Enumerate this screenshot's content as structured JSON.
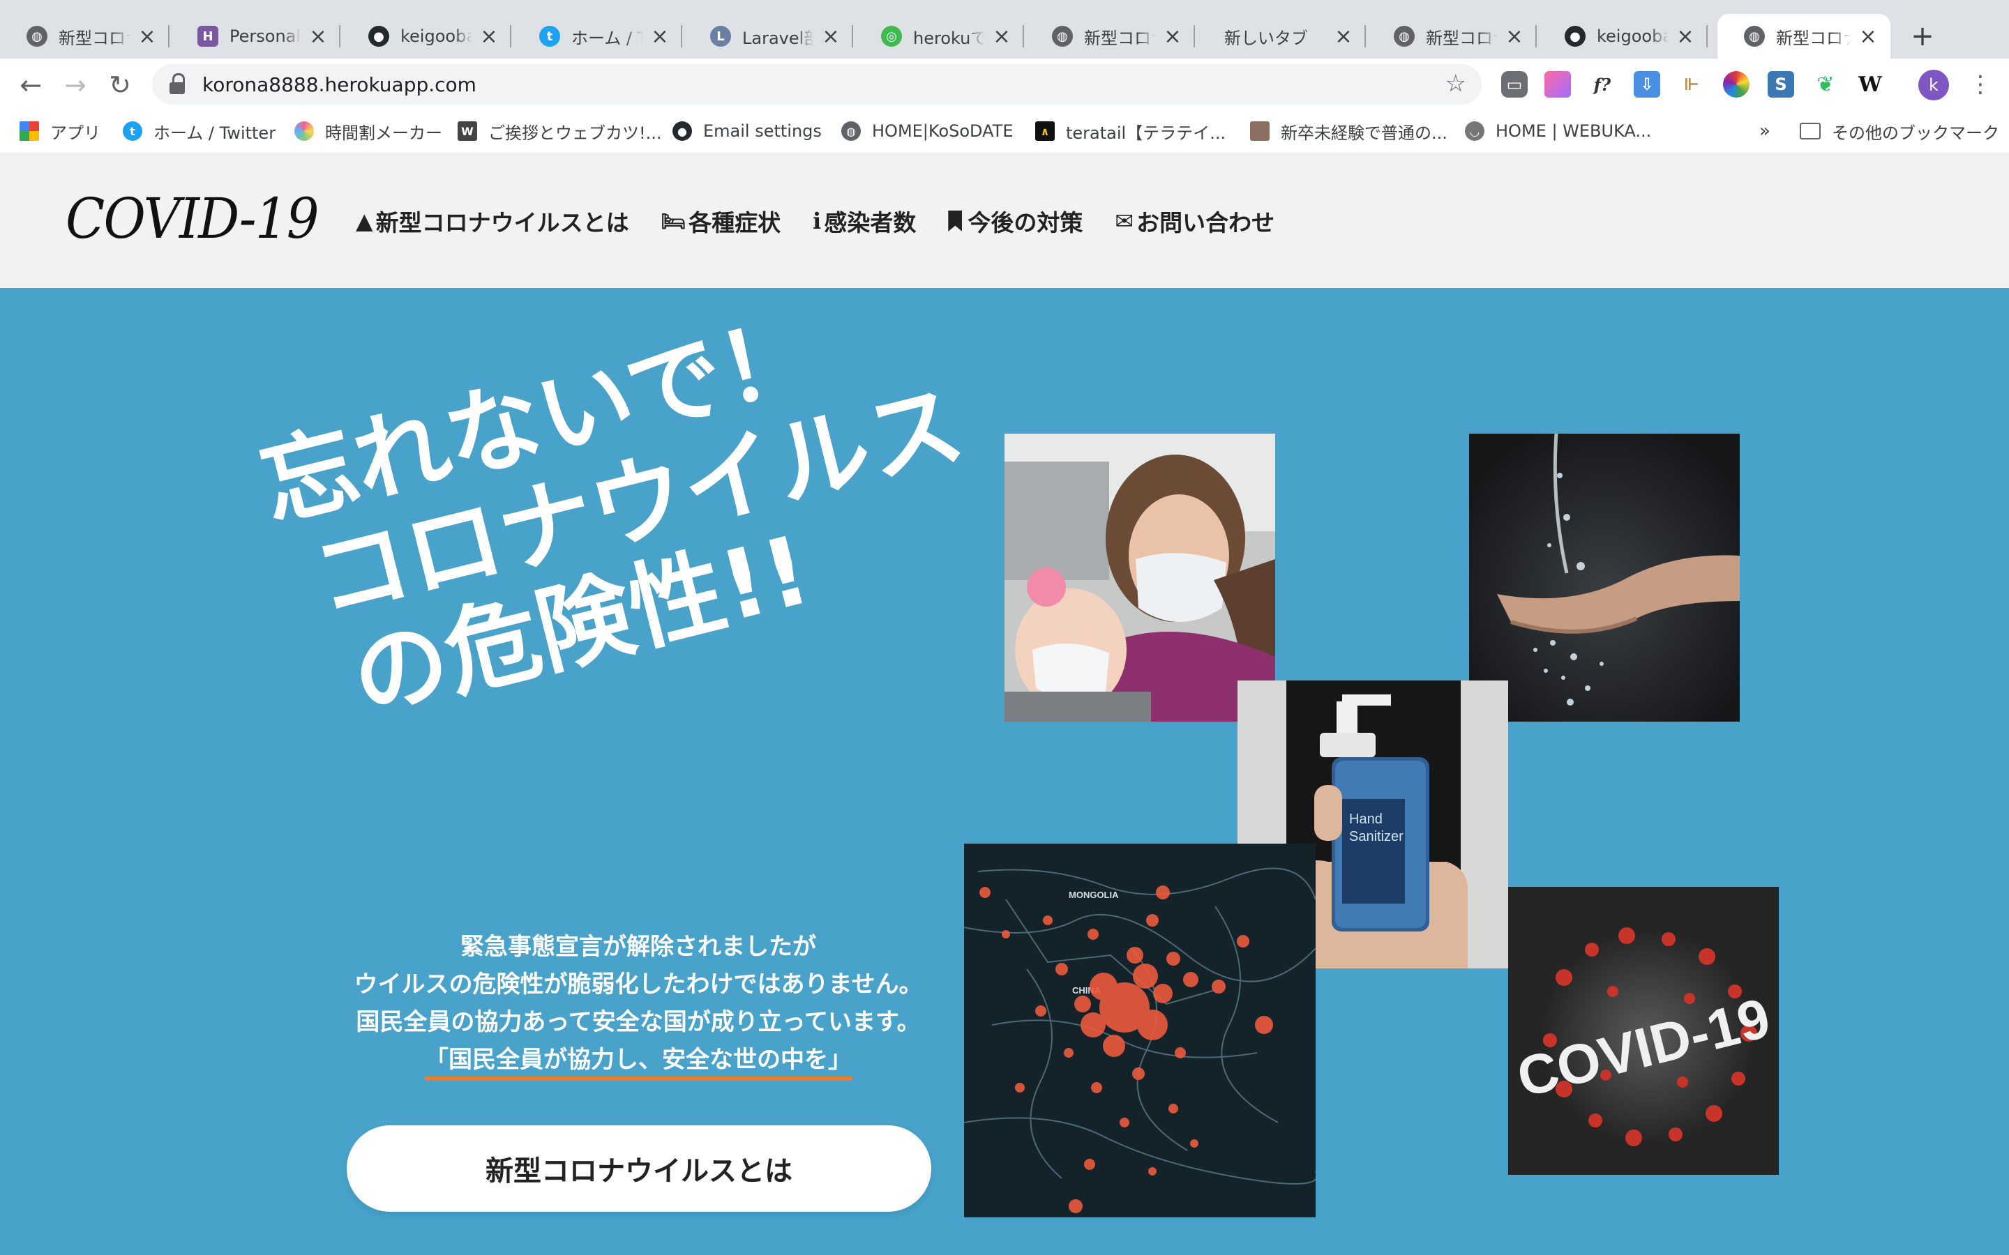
{
  "browser": {
    "tabs": [
      {
        "title": "新型コロナウイルス",
        "favicon": "globe-icon"
      },
      {
        "title": "Personal access",
        "favicon": "heroku-icon"
      },
      {
        "title": "keigooba/korona",
        "favicon": "github-icon"
      },
      {
        "title": "ホーム / Twitter",
        "favicon": "twitter-icon"
      },
      {
        "title": "Laravel部屋",
        "favicon": "laravel-icon"
      },
      {
        "title": "herokuでLaravel",
        "favicon": "heroku-icon"
      },
      {
        "title": "新型コロナウイルス",
        "favicon": "globe-icon"
      },
      {
        "title": "新しいタブ",
        "favicon": ""
      },
      {
        "title": "新型コロナウイルス",
        "favicon": "globe-icon"
      },
      {
        "title": "keigooba/korona",
        "favicon": "github-icon"
      },
      {
        "title": "新型コロナウイルス",
        "favicon": "globe-icon",
        "active": true
      }
    ],
    "url": "korona8888.herokuapp.com",
    "profile_initial": "k",
    "bookmarks": [
      {
        "label": "アプリ",
        "icon": "apps-grid-icon"
      },
      {
        "label": "ホーム / Twitter",
        "icon": "twitter-icon"
      },
      {
        "label": "時間割メーカー",
        "icon": "pie-icon"
      },
      {
        "label": "ご挨拶とウェブカツ!...",
        "icon": "webukatu-icon"
      },
      {
        "label": "Email settings",
        "icon": "github-icon"
      },
      {
        "label": "HOME|KoSoDATE",
        "icon": "globe-icon"
      },
      {
        "label": "teratail【テラテイ...",
        "icon": "teratail-icon"
      },
      {
        "label": "新卒未経験で普通の...",
        "icon": "avatar-icon"
      },
      {
        "label": "HOME | WEBUKA...",
        "icon": "ghost-icon"
      }
    ],
    "bookmarks_overflow": "»",
    "other_bookmarks": "その他のブックマーク"
  },
  "site": {
    "logo": "COVID-19",
    "nav": [
      {
        "label": "新型コロナウイルスとは",
        "icon": "warning-triangle-icon"
      },
      {
        "label": "各種症状",
        "icon": "bed-icon"
      },
      {
        "label": "感染者数",
        "icon": "person-icon"
      },
      {
        "label": "今後の対策",
        "icon": "bookmark-icon"
      },
      {
        "label": "お問い合わせ",
        "icon": "envelope-icon"
      }
    ],
    "hero": {
      "headline": [
        "忘れないで！",
        "コロナウイルス",
        "の危険性!!"
      ],
      "message": [
        "緊急事態宣言が解除されましたが",
        "ウイルスの危険性が脆弱化したわけではありません。",
        "国民全員の協力あって安全な国が成り立っています。"
      ],
      "highlight": "「国民全員が協力し、安全な世の中を」",
      "cta": "新型コロナウイルスとは",
      "map_labels": [
        "MONGOLIA",
        "CHINA"
      ],
      "poster_text": "COVID-19"
    }
  }
}
